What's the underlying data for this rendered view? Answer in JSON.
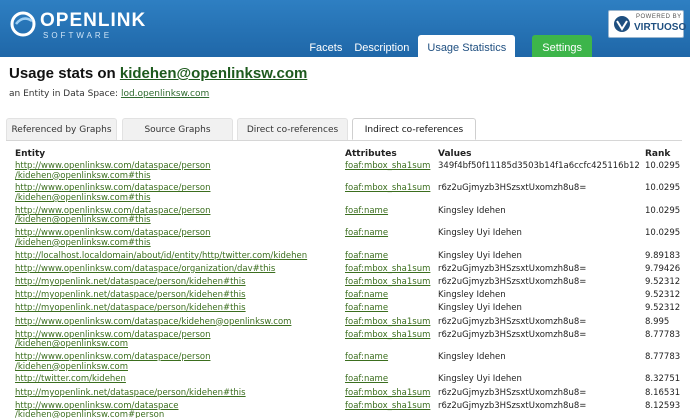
{
  "header": {
    "logo_name": "OPENLINK",
    "logo_sub": "SOFTWARE",
    "nav_tabs": [
      {
        "label": "Facets",
        "active": false
      },
      {
        "label": "Description",
        "active": false
      },
      {
        "label": "Usage Statistics",
        "active": true
      },
      {
        "label": "Settings",
        "active": false
      }
    ],
    "badge": {
      "powered": "POWERED BY",
      "name": "VIRTUOSO"
    }
  },
  "title": {
    "prefix": "Usage stats on ",
    "entity": "kidehen@openlinksw.com"
  },
  "subtitle": {
    "prefix": "an Entity in Data Space: ",
    "space": "lod.openlinksw.com"
  },
  "section_tabs": [
    {
      "label": "Referenced by Graphs",
      "active": false
    },
    {
      "label": "Source Graphs",
      "active": false
    },
    {
      "label": "Direct co-references",
      "active": false
    },
    {
      "label": "Indirect co-references",
      "active": true
    }
  ],
  "table": {
    "columns": [
      "Entity",
      "Attributes",
      "Values",
      "Rank"
    ],
    "rows": [
      {
        "entity": [
          "http://www.openlinksw.com/dataspace/person",
          "/kidehen@openlinksw.com#this"
        ],
        "attribute": "foaf:mbox_sha1sum",
        "value": "349f4bf50f11185d3503b14f1a6ccfc425116b12",
        "rank": "10.0295"
      },
      {
        "entity": [
          "http://www.openlinksw.com/dataspace/person",
          "/kidehen@openlinksw.com#this"
        ],
        "attribute": "foaf:mbox_sha1sum",
        "value": "r6z2uGjmyzb3HSzsxtUxomzh8u8=",
        "rank": "10.0295"
      },
      {
        "entity": [
          "http://www.openlinksw.com/dataspace/person",
          "/kidehen@openlinksw.com#this"
        ],
        "attribute": "foaf:name",
        "value": "Kingsley Idehen",
        "rank": "10.0295"
      },
      {
        "entity": [
          "http://www.openlinksw.com/dataspace/person",
          "/kidehen@openlinksw.com#this"
        ],
        "attribute": "foaf:name",
        "value": "Kingsley Uyi Idehen",
        "rank": "10.0295"
      },
      {
        "entity": [
          "http://localhost.localdomain/about/id/entity/http/twitter.com/kidehen"
        ],
        "attribute": "foaf:name",
        "value": "Kingsley Uyi Idehen",
        "rank": "9.89183"
      },
      {
        "entity": [
          "http://www.openlinksw.com/dataspace/organization/dav#this"
        ],
        "attribute": "foaf:mbox_sha1sum",
        "value": "r6z2uGjmyzb3HSzsxtUxomzh8u8=",
        "rank": "9.79426"
      },
      {
        "entity": [
          "http://myopenlink.net/dataspace/person/kidehen#this"
        ],
        "attribute": "foaf:mbox_sha1sum",
        "value": "r6z2uGjmyzb3HSzsxtUxomzh8u8=",
        "rank": "9.52312"
      },
      {
        "entity": [
          "http://myopenlink.net/dataspace/person/kidehen#this"
        ],
        "attribute": "foaf:name",
        "value": "Kingsley Idehen",
        "rank": "9.52312"
      },
      {
        "entity": [
          "http://myopenlink.net/dataspace/person/kidehen#this"
        ],
        "attribute": "foaf:name",
        "value": "Kingsley Uyi Idehen",
        "rank": "9.52312"
      },
      {
        "entity": [
          "http://www.openlinksw.com/dataspace/kidehen@openlinksw.com"
        ],
        "attribute": "foaf:mbox_sha1sum",
        "value": "r6z2uGjmyzb3HSzsxtUxomzh8u8=",
        "rank": "8.995"
      },
      {
        "entity": [
          "http://www.openlinksw.com/dataspace/person",
          "/kidehen@openlinksw.com"
        ],
        "attribute": "foaf:mbox_sha1sum",
        "value": "r6z2uGjmyzb3HSzsxtUxomzh8u8=",
        "rank": "8.77783"
      },
      {
        "entity": [
          "http://www.openlinksw.com/dataspace/person",
          "/kidehen@openlinksw.com"
        ],
        "attribute": "foaf:name",
        "value": "Kingsley Idehen",
        "rank": "8.77783"
      },
      {
        "entity": [
          "http://twitter.com/kidehen"
        ],
        "attribute": "foaf:name",
        "value": "Kingsley Uyi Idehen",
        "rank": "8.32751"
      },
      {
        "entity": [
          "http://myopenlink.net/dataspace/person/kidehen#this"
        ],
        "attribute": "foaf:mbox_sha1sum",
        "value": "r6z2uGjmyzb3HSzsxtUxomzh8u8=",
        "rank": "8.16531"
      },
      {
        "entity": [
          "http://www.openlinksw.com/dataspace",
          "/kidehen@openlinksw.com#person"
        ],
        "attribute": "foaf:mbox_sha1sum",
        "value": "r6z2uGjmyzb3HSzsxtUxomzh8u8=",
        "rank": "8.12593"
      }
    ]
  }
}
